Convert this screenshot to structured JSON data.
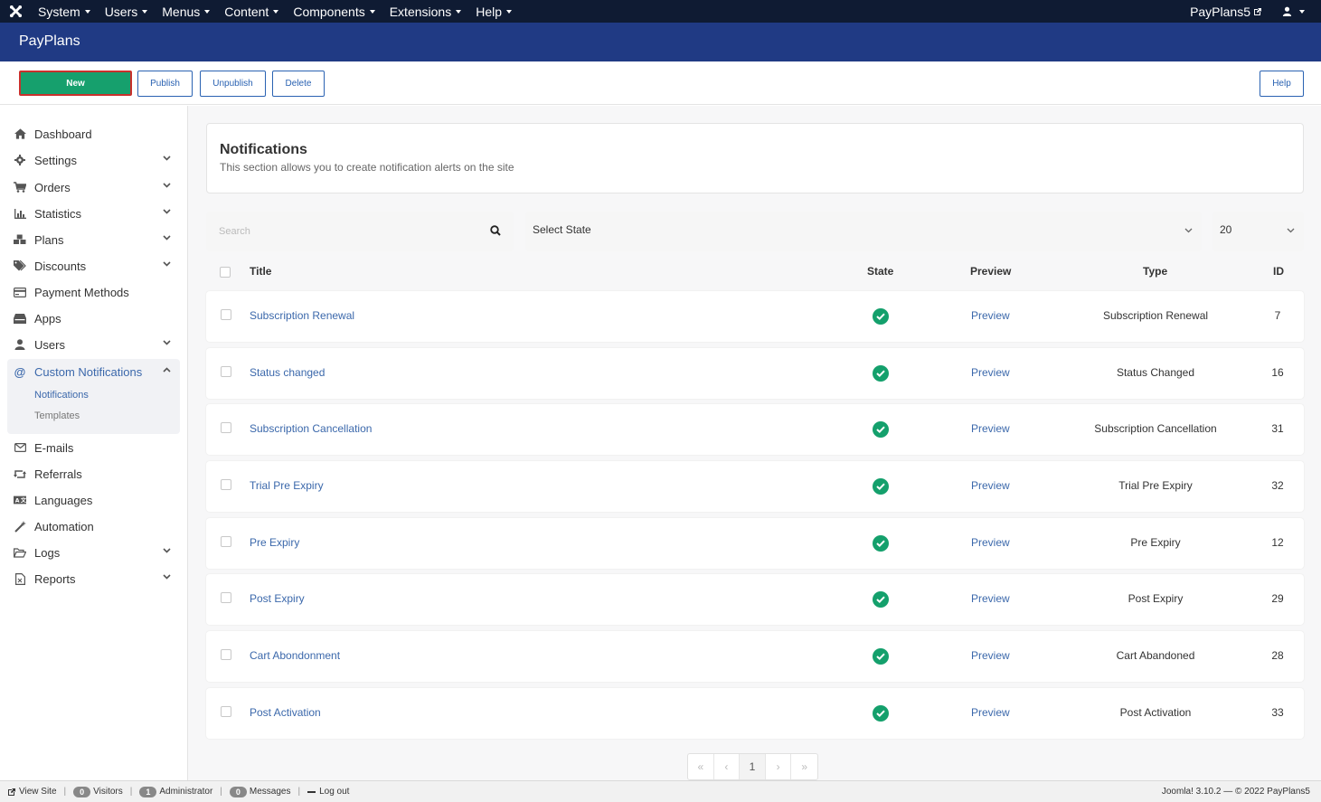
{
  "topbar": {
    "menu": [
      "System",
      "Users",
      "Menus",
      "Content",
      "Components",
      "Extensions",
      "Help"
    ],
    "site_name": "PayPlans5"
  },
  "header": {
    "title": "PayPlans"
  },
  "toolbar": {
    "new_label": "New",
    "publish_label": "Publish",
    "unpublish_label": "Unpublish",
    "delete_label": "Delete",
    "help_label": "Help"
  },
  "sidebar": {
    "items": [
      {
        "label": "Dashboard",
        "icon": "home-icon",
        "expandable": false
      },
      {
        "label": "Settings",
        "icon": "gear-icon",
        "expandable": true
      },
      {
        "label": "Orders",
        "icon": "cart-icon",
        "expandable": true
      },
      {
        "label": "Statistics",
        "icon": "chart-icon",
        "expandable": true
      },
      {
        "label": "Plans",
        "icon": "cubes-icon",
        "expandable": true
      },
      {
        "label": "Discounts",
        "icon": "tags-icon",
        "expandable": true
      },
      {
        "label": "Payment Methods",
        "icon": "credit-card-icon",
        "expandable": false
      },
      {
        "label": "Apps",
        "icon": "apps-icon",
        "expandable": false
      },
      {
        "label": "Users",
        "icon": "user-icon",
        "expandable": true
      },
      {
        "label": "Custom Notifications",
        "icon": "at-icon",
        "expandable": true,
        "expanded": true
      },
      {
        "label": "E-mails",
        "icon": "envelope-icon",
        "expandable": false
      },
      {
        "label": "Referrals",
        "icon": "retweet-icon",
        "expandable": false
      },
      {
        "label": "Languages",
        "icon": "language-icon",
        "expandable": false
      },
      {
        "label": "Automation",
        "icon": "magic-icon",
        "expandable": false
      },
      {
        "label": "Logs",
        "icon": "folder-icon",
        "expandable": true
      },
      {
        "label": "Reports",
        "icon": "file-icon",
        "expandable": true
      }
    ],
    "sub_items": [
      "Notifications",
      "Templates"
    ]
  },
  "page": {
    "title": "Notifications",
    "description": "This section allows you to create notification alerts on the site"
  },
  "filters": {
    "search_placeholder": "Search",
    "state_label": "Select State",
    "limit_value": "20"
  },
  "table": {
    "headers": {
      "title": "Title",
      "state": "State",
      "preview": "Preview",
      "type": "Type",
      "id": "ID"
    },
    "rows": [
      {
        "title": "Subscription Renewal",
        "preview": "Preview",
        "type": "Subscription Renewal",
        "id": "7"
      },
      {
        "title": "Status changed",
        "preview": "Preview",
        "type": "Status Changed",
        "id": "16"
      },
      {
        "title": "Subscription Cancellation",
        "preview": "Preview",
        "type": "Subscription Cancellation",
        "id": "31"
      },
      {
        "title": "Trial Pre Expiry",
        "preview": "Preview",
        "type": "Trial Pre Expiry",
        "id": "32"
      },
      {
        "title": "Pre Expiry",
        "preview": "Preview",
        "type": "Pre Expiry",
        "id": "12"
      },
      {
        "title": "Post Expiry",
        "preview": "Preview",
        "type": "Post Expiry",
        "id": "29"
      },
      {
        "title": "Cart Abondonment",
        "preview": "Preview",
        "type": "Cart Abandoned",
        "id": "28"
      },
      {
        "title": "Post Activation",
        "preview": "Preview",
        "type": "Post Activation",
        "id": "33"
      }
    ]
  },
  "pagination": {
    "first": "«",
    "prev": "‹",
    "current": "1",
    "next": "›",
    "last": "»"
  },
  "statusbar": {
    "view_site": "View Site",
    "visitors_count": "0",
    "visitors_label": "Visitors",
    "admin_count": "1",
    "admin_label": "Administrator",
    "messages_count": "0",
    "messages_label": "Messages",
    "logout": "Log out",
    "version": "Joomla! 3.10.2 — © 2022 PayPlans5"
  },
  "colors": {
    "topbar": "#0f1b33",
    "header": "#203a84",
    "new_button": "#16a06d",
    "link": "#3b68ab",
    "state_ok": "#14a06c"
  }
}
